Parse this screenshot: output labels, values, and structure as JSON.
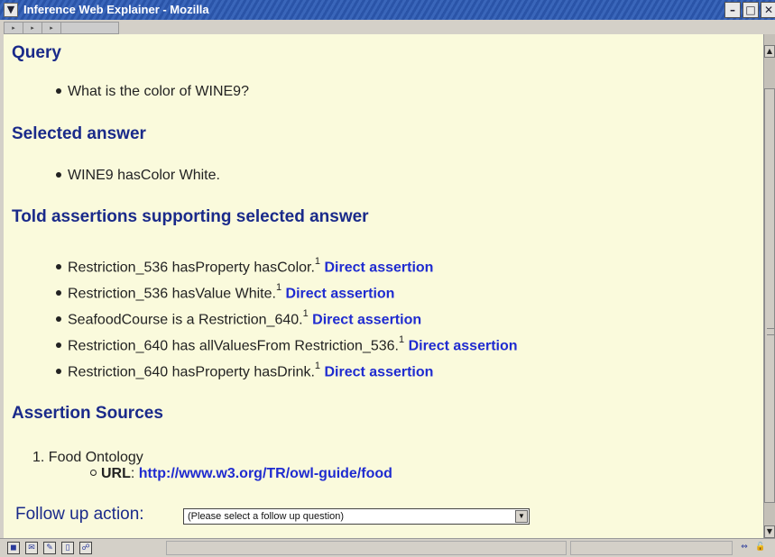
{
  "window": {
    "title": "Inference Web Explainer - Mozilla",
    "menu_glyph": "▼",
    "minimize": "–",
    "maximize": "□",
    "close": "✕"
  },
  "nav_arrows": [
    "▸",
    "▸",
    "▸"
  ],
  "sections": {
    "query_heading": "Query",
    "query_item": "What is the color of WINE9?",
    "selected_heading": "Selected answer",
    "selected_item": "WINE9 hasColor White.",
    "told_heading": "Told assertions supporting selected answer",
    "assertions": [
      {
        "text": "Restriction_536 hasProperty hasColor.",
        "sup": "1",
        "link": "Direct assertion"
      },
      {
        "text": "Restriction_536 hasValue White.",
        "sup": "1",
        "link": "Direct assertion"
      },
      {
        "text": "SeafoodCourse is a Restriction_640.",
        "sup": "1",
        "link": "Direct assertion"
      },
      {
        "text": "Restriction_640 has allValuesFrom Restriction_536.",
        "sup": "1",
        "link": "Direct assertion"
      },
      {
        "text": "Restriction_640 hasProperty hasDrink.",
        "sup": "1",
        "link": "Direct assertion"
      }
    ],
    "sources_heading": "Assertion Sources",
    "source_number": "1.",
    "source_name": "Food Ontology",
    "source_url_label": "URL",
    "source_url": "http://www.w3.org/TR/owl-guide/food"
  },
  "follow_up": {
    "label": "Follow up action:",
    "selected_option": "(Please select a follow up question)"
  },
  "colors": {
    "title_bar": "#2a54a8",
    "page_bg": "#fafadc",
    "heading": "#1a2a8a",
    "link": "#1f2bd0"
  },
  "statusbar_icons": [
    "navigator-icon",
    "mail-icon",
    "composer-icon",
    "address-book-icon",
    "chatzilla-icon"
  ]
}
